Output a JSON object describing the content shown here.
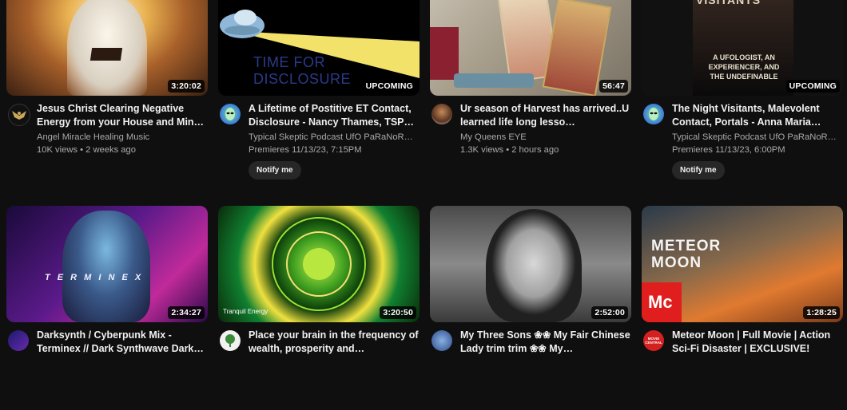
{
  "videos": [
    {
      "title": "Jesus Christ Clearing Negative Energy from your House and Min…",
      "channel": "Angel Miracle Healing Music",
      "stats": "10K views • 2 weeks ago",
      "badge": "3:20:02"
    },
    {
      "title": "A Lifetime of Postitive ET Contact, Disclosure - Nancy Thames, TSP…",
      "channel": "Typical Skeptic Podcast UfO PaRaNoR…",
      "stats": "Premieres 11/13/23, 7:15PM",
      "badge": "UPCOMING",
      "notify": "Notify me",
      "thumb_text": "TIME FOR DISCLOSURE"
    },
    {
      "title": "Ur season of Harvest has arrived..U learned life long lesso…",
      "channel": "My Queens EYE",
      "stats": "1.3K views • 2 hours ago",
      "badge": "56:47"
    },
    {
      "title": "The Night Visitants, Malevolent Contact, Portals - Anna Maria…",
      "channel": "Typical Skeptic Podcast UfO PaRaNoR…",
      "stats": "Premieres 11/13/23, 6:00PM",
      "badge": "UPCOMING",
      "notify": "Notify me",
      "thumb_text": "A UFOLOGIST, AN EXPERIENCER, AND THE UNDEFINABLE",
      "thumb_title": "VISITANTS"
    },
    {
      "title": "Darksynth / Cyberpunk Mix - Terminex // Dark Synthwave Dark…",
      "badge": "2:34:27",
      "thumb_text": "T E R M I N E X"
    },
    {
      "title": "Place your brain in the frequency of wealth, prosperity and…",
      "badge": "3:20:50",
      "thumb_text": "Tranquil Energy"
    },
    {
      "title": "My Three Sons ❀❀ My Fair Chinese Lady trim trim ❀❀ My…",
      "badge": "2:52:00"
    },
    {
      "title": "Meteor Moon | Full Movie | Action Sci-Fi Disaster | EXCLUSIVE!",
      "badge": "1:28:25",
      "thumb_text": "METEOR MOON",
      "logo_text": "Mc",
      "avatar_text": "MOVIE CENTRAL"
    }
  ],
  "colors": {
    "background": "#0f0f0f",
    "title": "#f1f1f1",
    "secondary": "#aaaaaa",
    "button": "#272727"
  }
}
